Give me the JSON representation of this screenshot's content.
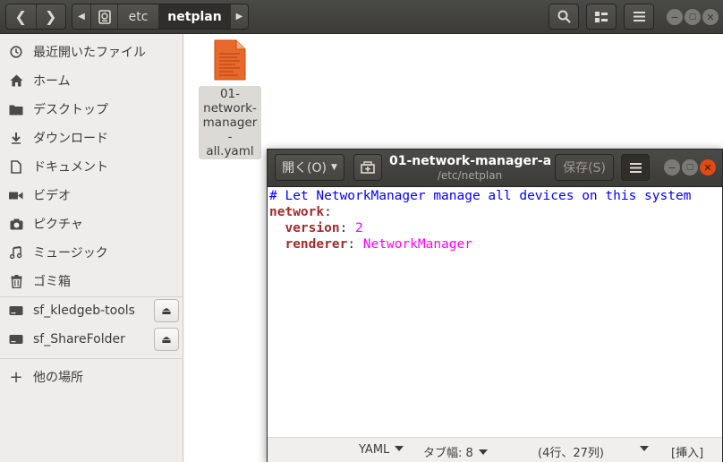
{
  "path": {
    "segments": [
      "etc",
      "netplan"
    ]
  },
  "sidebar": {
    "items": [
      {
        "label": "最近開いたファイル",
        "icon": "recent-icon"
      },
      {
        "label": "ホーム",
        "icon": "home-icon"
      },
      {
        "label": "デスクトップ",
        "icon": "folder-icon"
      },
      {
        "label": "ダウンロード",
        "icon": "download-icon"
      },
      {
        "label": "ドキュメント",
        "icon": "document-icon"
      },
      {
        "label": "ビデオ",
        "icon": "video-icon"
      },
      {
        "label": "ピクチャ",
        "icon": "camera-icon"
      },
      {
        "label": "ミュージック",
        "icon": "music-icon"
      },
      {
        "label": "ゴミ箱",
        "icon": "trash-icon"
      }
    ],
    "drives": [
      {
        "label": "sf_kledgeb-tools",
        "icon": "drive-icon"
      },
      {
        "label": "sf_ShareFolder",
        "icon": "drive-icon"
      }
    ],
    "other_locations": "他の場所"
  },
  "files": [
    {
      "name": "01-network-manager-all.yaml",
      "display": "01-\nnetwork-\nmanager-\nall.yaml",
      "icon": "yaml-file-icon"
    }
  ],
  "gedit": {
    "open_button": "開く(O)",
    "title": "01-network-manager-a...",
    "subtitle": "/etc/netplan",
    "save_button": "保存(S)",
    "code": {
      "comment": "# Let NetworkManager manage all devices on this system",
      "key_network": "network",
      "key_version": "version",
      "val_version": "2",
      "key_renderer": "renderer",
      "val_renderer": "NetworkManager"
    },
    "status": {
      "language": "YAML",
      "tab_width": "タブ幅: 8",
      "position": "(4行、27列)",
      "mode": "[挿入]"
    }
  },
  "colors": {
    "headerbar": "#3c3b37",
    "close_button": "#df4a16",
    "comment": "#0000ff",
    "key": "#a52a2a",
    "value": "#ff00ff"
  }
}
